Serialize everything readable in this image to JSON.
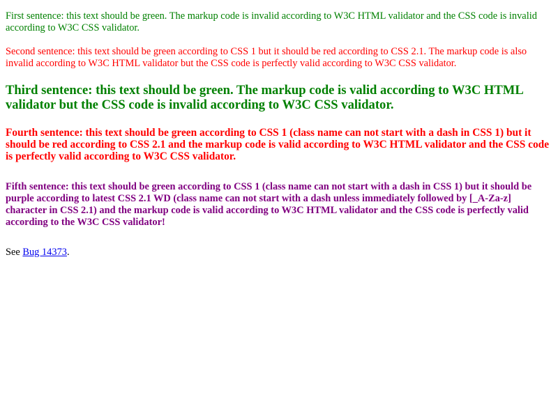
{
  "colors": {
    "green": "#008000",
    "red": "#ff0000",
    "purple": "#800080",
    "link": "#0000ee",
    "text": "#000000"
  },
  "sentences": [
    {
      "text": "First sentence: this text should be green. The markup code is invalid according to W3C HTML validator and the CSS code is invalid according to W3C CSS validator.",
      "color": "#008000"
    },
    {
      "text": "Second sentence: this text should be green according to CSS 1 but it should be red according to CSS 2.1. The markup code is also invalid according to W3C HTML validator but the CSS code is perfectly valid according to W3C CSS validator.",
      "color": "#ff0000"
    },
    {
      "text": "Third sentence: this text should be green. The markup code is valid according to W3C HTML validator but the CSS code is invalid according to W3C CSS validator.",
      "color": "#008000"
    },
    {
      "text": "Fourth sentence: this text should be green according to CSS 1 (class name can not start with a dash in CSS 1) but it should be red according to CSS 2.1 and the markup code is valid according to W3C HTML validator and the CSS code is perfectly valid according to W3C CSS validator.",
      "color": "#ff0000"
    },
    {
      "text": "Fifth sentence: this text should be green according to CSS 1 (class name can not start with a dash in CSS 1) but it should be purple according to latest CSS 2.1 WD (class name can not start with a dash unless immediately followed by [_A-Za-z] character in CSS 2.1) and the markup code is valid according to W3C HTML validator and the CSS code is perfectly valid according to the W3C CSS validator!",
      "color": "#800080"
    }
  ],
  "footer": {
    "prefix": "See ",
    "link_text": "Bug 14373",
    "suffix": "."
  }
}
